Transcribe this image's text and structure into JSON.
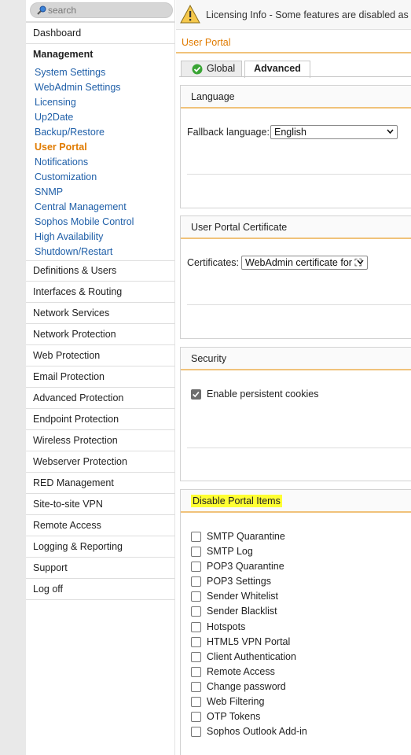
{
  "search": {
    "placeholder": "search"
  },
  "sidebar": {
    "dashboard": "Dashboard",
    "management_title": "Management",
    "management_items": [
      "System Settings",
      "WebAdmin Settings",
      "Licensing",
      "Up2Date",
      "Backup/Restore",
      "User Portal",
      "Notifications",
      "Customization",
      "SNMP",
      "Central Management",
      "Sophos Mobile Control",
      "High Availability",
      "Shutdown/Restart"
    ],
    "active_item": "User Portal",
    "sections": [
      "Definitions & Users",
      "Interfaces & Routing",
      "Network Services",
      "Network Protection",
      "Web Protection",
      "Email Protection",
      "Advanced Protection",
      "Endpoint Protection",
      "Wireless Protection",
      "Webserver Protection",
      "RED Management",
      "Site-to-site VPN",
      "Remote Access",
      "Logging & Reporting",
      "Support",
      "Log off"
    ]
  },
  "banner": {
    "title": "Licensing Info",
    "message": " - Some features are disabled as yo"
  },
  "page": {
    "title": "User Portal"
  },
  "tabs": {
    "global": "Global",
    "advanced": "Advanced"
  },
  "language": {
    "heading": "Language",
    "label": "Fallback language:",
    "value": "English"
  },
  "certificate": {
    "heading": "User Portal Certificate",
    "label": "Certificates:",
    "value": "WebAdmin certificate for ⛶"
  },
  "security": {
    "heading": "Security",
    "persistent_cookies_label": "Enable persistent cookies",
    "persistent_cookies_checked": true
  },
  "disable_items": {
    "heading": "Disable Portal Items",
    "items": [
      "SMTP Quarantine",
      "SMTP Log",
      "POP3 Quarantine",
      "POP3 Settings",
      "Sender Whitelist",
      "Sender Blacklist",
      "Hotspots",
      "HTML5 VPN Portal",
      "Client Authentication",
      "Remote Access",
      "Change password",
      "Web Filtering",
      "OTP Tokens",
      "Sophos Outlook Add-in"
    ]
  },
  "colors": {
    "accent": "#e07b00",
    "link": "#1f5fa8",
    "highlight": "#ffff33",
    "header_line": "#f0c27a"
  }
}
